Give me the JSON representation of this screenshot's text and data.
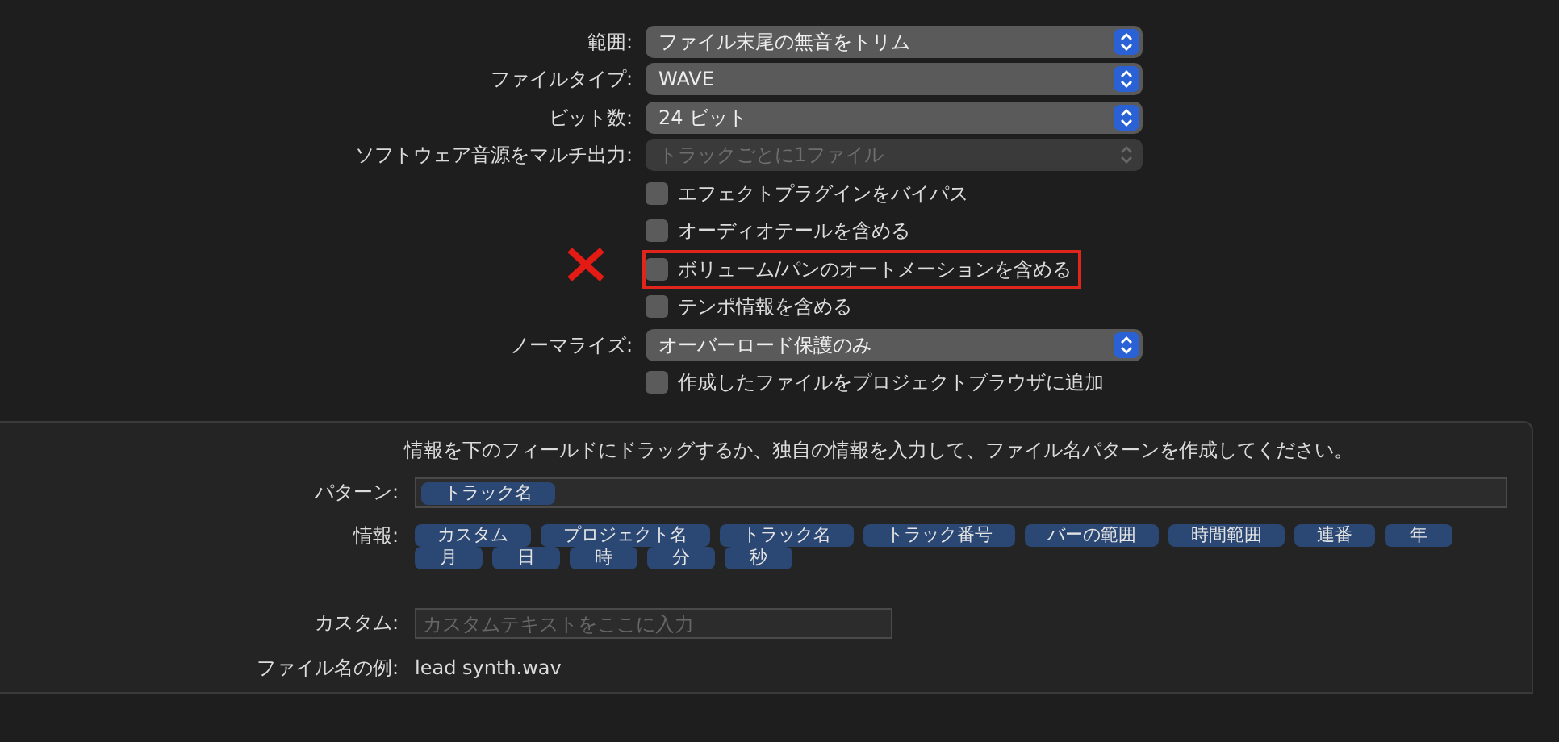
{
  "settings": [
    {
      "kind": "select",
      "label": "範囲:",
      "value": "ファイル末尾の無音をトリム",
      "disabled": false
    },
    {
      "kind": "select",
      "label": "ファイルタイプ:",
      "value": "WAVE",
      "disabled": false
    },
    {
      "kind": "select",
      "label": "ビット数:",
      "value": "24 ビット",
      "disabled": false
    },
    {
      "kind": "select",
      "label": "ソフトウェア音源をマルチ出力:",
      "value": "トラックごとに1ファイル",
      "disabled": true
    },
    {
      "kind": "checkbox",
      "label": "エフェクトプラグインをバイパス",
      "checked": false,
      "highlighted": false
    },
    {
      "kind": "checkbox",
      "label": "オーディオテールを含める",
      "checked": false,
      "highlighted": false
    },
    {
      "kind": "checkbox",
      "label": "ボリューム/パンのオートメーションを含める",
      "checked": false,
      "highlighted": true
    },
    {
      "kind": "checkbox",
      "label": "テンポ情報を含める",
      "checked": false,
      "highlighted": false
    },
    {
      "kind": "select",
      "label": "ノーマライズ:",
      "value": "オーバーロード保護のみ",
      "disabled": false
    },
    {
      "kind": "checkbox",
      "label": "作成したファイルをプロジェクトブラウザに追加",
      "checked": false,
      "highlighted": false
    }
  ],
  "naming": {
    "instruction": "情報を下のフィールドにドラッグするか、独自の情報を入力して、ファイル名パターンを作成してください。",
    "pattern_label": "パターン:",
    "pattern_tokens": [
      "トラック名"
    ],
    "info_label": "情報:",
    "info_tokens": [
      "カスタム",
      "プロジェクト名",
      "トラック名",
      "トラック番号",
      "バーの範囲",
      "時間範囲",
      "連番",
      "年",
      "月",
      "日",
      "時",
      "分",
      "秒"
    ],
    "custom_label": "カスタム:",
    "custom_placeholder": "カスタムテキストをここに入力",
    "example_label": "ファイル名の例:",
    "example_value": "lead synth.wav"
  }
}
